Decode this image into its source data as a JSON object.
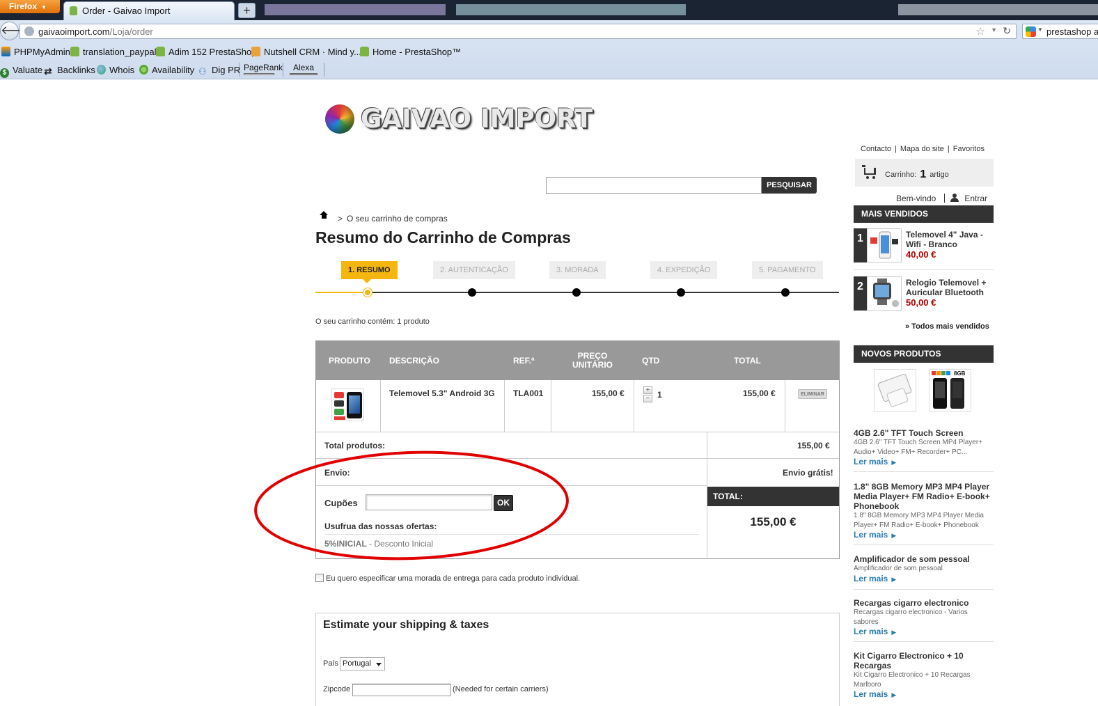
{
  "browser": {
    "app_button": "Firefox",
    "tab_title": "Order - Gaivao Import",
    "url_host": "gaivaoimport.com",
    "url_path": "/Loja/order",
    "search_text": "prestashop a",
    "bookmarks_row1": [
      "PHPMyAdmin",
      "translation_paypal",
      "Adim 152 PrestaShop",
      "Nutshell CRM · Mind y...",
      "Home - PrestaShop™"
    ],
    "bookmarks_row2": [
      "Valuate",
      "Backlinks",
      "Whois",
      "Availability",
      "Dig PR"
    ],
    "toolbar_pagerank": "PageRank",
    "toolbar_alexa": "Alexa"
  },
  "header": {
    "logo_text": "GAIVAO IMPORT",
    "links": [
      "Contacto",
      "Mapa do site",
      "Favoritos"
    ],
    "cart": {
      "label": "Carrinho:",
      "count": "1",
      "unit": "artigo"
    },
    "search_button": "PESQUISAR",
    "welcome": "Bem-vindo",
    "login": "Entrar"
  },
  "breadcrumb": {
    "current": "O seu carrinho de compras"
  },
  "page_title": "Resumo do Carrinho de Compras",
  "steps": [
    "1. RESUMO",
    "2. AUTENTICAÇÃO",
    "3. MORADA",
    "4. EXPEDIÇÃO",
    "5. PAGAMENTO"
  ],
  "summary_text": "O seu carrinho contém: 1 produto",
  "cart_table": {
    "headers": {
      "product": "PRODUTO",
      "description": "DESCRIÇÃO",
      "ref": "REF.ª",
      "unit_price": "PREÇO UNITÁRIO",
      "qty": "QTD",
      "total": "TOTAL"
    },
    "rows": [
      {
        "description": "Telemovel 5.3\" Android 3G",
        "ref": "TLA001",
        "unit_price": "155,00 €",
        "qty": "1",
        "total": "155,00 €",
        "delete": "ELIMINAR"
      }
    ],
    "total_products_label": "Total produtos:",
    "total_products_value": "155,00 €",
    "shipping_label": "Envio:",
    "shipping_value": "Envio grátis!",
    "total_label": "TOTAL:",
    "total_value": "155,00 €",
    "coupons_label": "Cupões",
    "coupon_ok": "OK",
    "offers_label": "Usufrua das nossas ofertas:",
    "offer_code": "5%INICIAL",
    "offer_desc": " - Desconto Inicial"
  },
  "multi_address": "Eu quero especificar uma morada de entrega para cada produto individual.",
  "estimate": {
    "title": "Estimate your shipping & taxes",
    "country_label": "País",
    "country_value": "Portugal",
    "zip_label": "Zipcode",
    "zip_note": "(Needed for certain carriers)"
  },
  "sidebar": {
    "best_title": "MAIS VENDIDOS",
    "best": [
      {
        "rank": "1",
        "name": "Telemovel 4\" Java - Wifi - Branco",
        "price": "40,00 €"
      },
      {
        "rank": "2",
        "name": "Relogio Telemovel + Auricular Bluetooth",
        "price": "50,00 €"
      }
    ],
    "all_best": "» Todos mais vendidos",
    "new_title": "NOVOS PRODUTOS",
    "new_items": [
      {
        "title": "4GB 2.6\" TFT Touch Screen",
        "desc": "4GB 2.6\" TFT Touch Screen MP4 Player+ Audio+ Video+ FM+ Recorder+ PC...",
        "more": "Ler mais"
      },
      {
        "title": "1.8\" 8GB Memory MP3 MP4 Player Media Player+ FM Radio+ E-book+ Phonebook",
        "desc": "1.8\" 8GB Memory MP3 MP4 Player Media Player+ FM Radio+ E-book+ Phonebook",
        "more": "Ler mais"
      },
      {
        "title": "Amplificador de som pessoal",
        "desc": "Amplificador de som pessoal",
        "more": "Ler mais"
      },
      {
        "title": "Recargas cigarro electronico",
        "desc": "Recargas cigarro electronico - Varios sabores",
        "more": "Ler mais"
      },
      {
        "title": "Kit Cigarro Electronico + 10 Recargas",
        "desc": "Kit Cigarro Electronico + 10 Recargas Marlboro",
        "more": "Ler mais"
      }
    ],
    "new_thumb_label": "8GB"
  },
  "colors": {
    "accent": "#f5b70f",
    "dark": "#333333",
    "price": "#b30000",
    "link": "#2a7ab0",
    "annotation": "#e00000"
  }
}
